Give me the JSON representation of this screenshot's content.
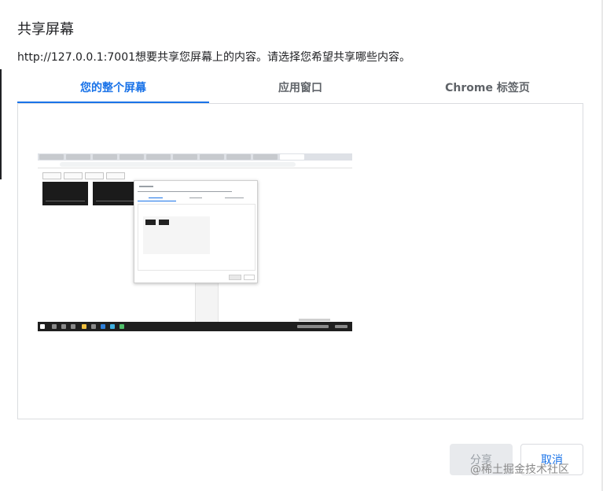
{
  "dialog": {
    "title": "共享屏幕",
    "prompt": "http://127.0.0.1:7001想要共享您屏幕上的内容。请选择您希望共享哪些内容。"
  },
  "tabs": [
    {
      "label": "您的整个屏幕",
      "active": true
    },
    {
      "label": "应用窗口",
      "active": false
    },
    {
      "label": "Chrome 标签页",
      "active": false
    }
  ],
  "buttons": {
    "share_label": "分享",
    "cancel_label": "取消",
    "share_enabled": false
  },
  "watermark": "@稀土掘金技术社区",
  "colors": {
    "accent": "#1a73e8",
    "disabled_bg": "#e8eaed",
    "disabled_text": "#9aa0a6",
    "border": "#dadce0"
  }
}
